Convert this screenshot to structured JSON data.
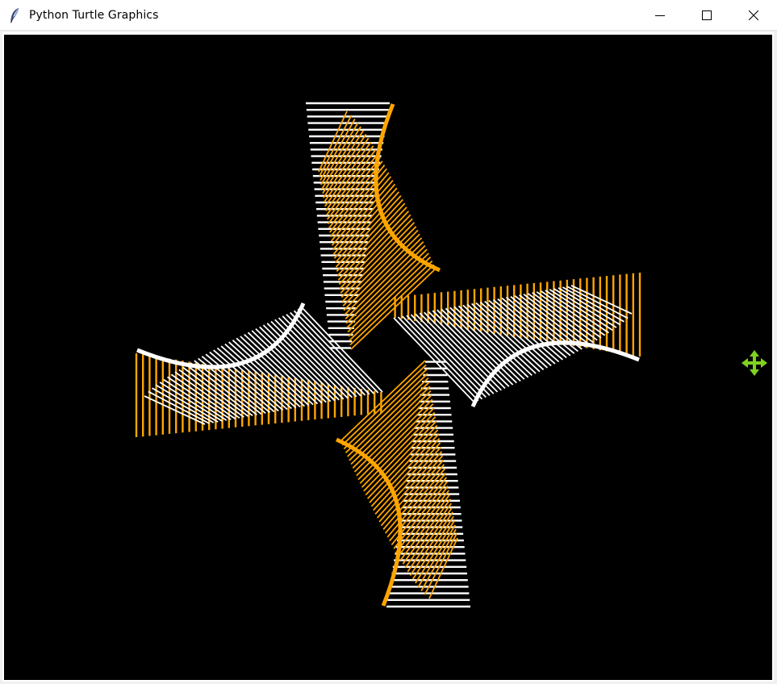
{
  "window": {
    "title": "Python Turtle Graphics",
    "app_icon": "feather-icon",
    "controls": {
      "minimize": "minimize-icon",
      "maximize": "maximize-icon",
      "close": "close-icon"
    }
  },
  "canvas": {
    "background": "#000000",
    "colors": {
      "orange": "#ffa500",
      "white": "#ffffff"
    },
    "cursor": "move-icon",
    "cursor_color": "#7ed321"
  }
}
